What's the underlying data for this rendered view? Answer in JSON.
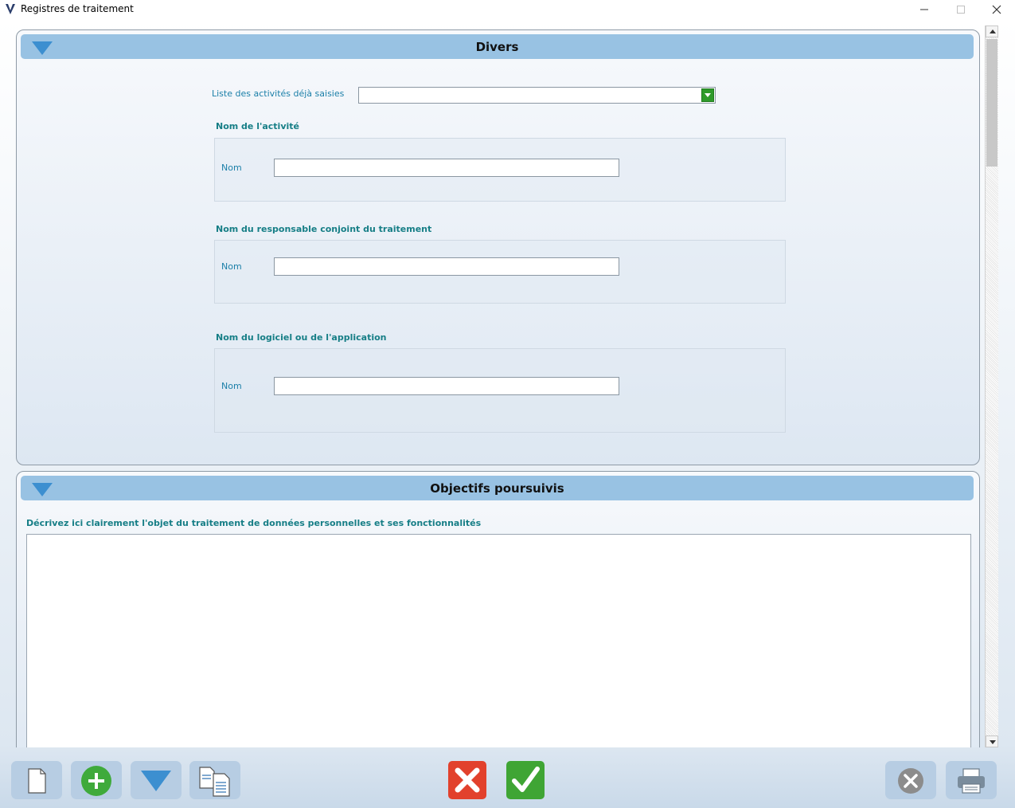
{
  "window": {
    "title": "Registres de traitement",
    "minimize_icon": "minimize-icon",
    "maximize_icon": "maximize-icon",
    "close_icon": "close-icon"
  },
  "divers": {
    "title": "Divers",
    "activities_label": "Liste des activités déjà saisies",
    "activities_value": "",
    "activity_group": "Nom de l'activité",
    "activity_name_label": "Nom",
    "activity_name_value": "",
    "joint_group": "Nom du responsable conjoint du traitement",
    "joint_name_label": "Nom",
    "joint_name_value": "",
    "software_group": "Nom du logiciel ou de l'application",
    "software_name_label": "Nom",
    "software_name_value": ""
  },
  "objectifs": {
    "title": "Objectifs poursuivis",
    "description_label": "Décrivez ici clairement l'objet du traitement de données personnelles et ses fonctionnalités",
    "description_value": ""
  },
  "toolbar": {
    "buttons": [
      {
        "icon": "new-document-icon"
      },
      {
        "icon": "add-icon",
        "color": "#3faa3b"
      },
      {
        "icon": "dropdown-arrow-icon",
        "color": "#3c8fd0"
      },
      {
        "icon": "copy-icon"
      },
      {
        "icon": "cancel-icon",
        "color": "#e2412c"
      },
      {
        "icon": "validate-icon",
        "color": "#3fa534"
      },
      {
        "icon": "close-circle-icon",
        "color": "#8c8c8c"
      },
      {
        "icon": "printer-icon"
      }
    ]
  }
}
